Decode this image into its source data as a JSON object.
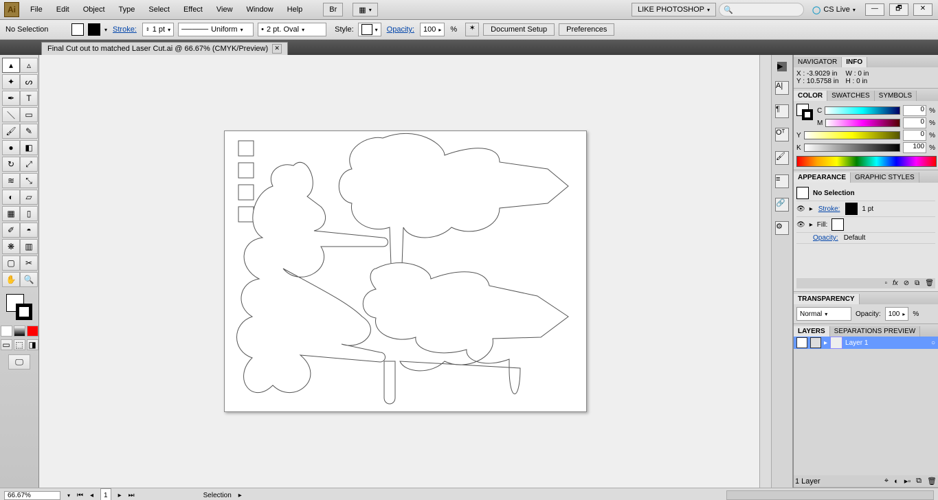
{
  "menu": [
    "File",
    "Edit",
    "Object",
    "Type",
    "Select",
    "Effect",
    "View",
    "Window",
    "Help"
  ],
  "workspace_name": "LIKE PHOTOSHOP",
  "cslive": "CS Live",
  "control": {
    "selection_state": "No Selection",
    "stroke_label": "Stroke:",
    "stroke_weight": "1 pt",
    "profile": "Uniform",
    "brush": "2 pt. Oval",
    "style_label": "Style:",
    "opacity_label": "Opacity:",
    "opacity_value": "100",
    "doc_setup": "Document Setup",
    "prefs": "Preferences"
  },
  "document_tab": "Final Cut out to matched Laser Cut.ai @ 66.67% (CMYK/Preview)",
  "navigator": {
    "tab1": "NAVIGATOR",
    "tab2": "INFO",
    "x": "-3.9029 in",
    "y": "10.5758 in",
    "w": "0 in",
    "h": "0 in"
  },
  "color": {
    "tab1": "COLOR",
    "tab2": "SWATCHES",
    "tab3": "SYMBOLS",
    "c": "0",
    "m": "0",
    "y": "0",
    "k": "100"
  },
  "appearance": {
    "tab1": "APPEARANCE",
    "tab2": "GRAPHIC STYLES",
    "no_sel": "No Selection",
    "stroke": "Stroke:",
    "stroke_val": "1 pt",
    "fill": "Fill:",
    "opacity": "Opacity:",
    "opacity_val": "Default"
  },
  "transparency": {
    "tab": "TRANSPARENCY",
    "mode": "Normal",
    "opacity_label": "Opacity:",
    "opacity_value": "100"
  },
  "layers": {
    "tab1": "LAYERS",
    "tab2": "SEPARATIONS PREVIEW",
    "layer_name": "Layer 1",
    "count": "1 Layer"
  },
  "status": {
    "zoom": "66.67%",
    "page": "1",
    "tool": "Selection"
  }
}
